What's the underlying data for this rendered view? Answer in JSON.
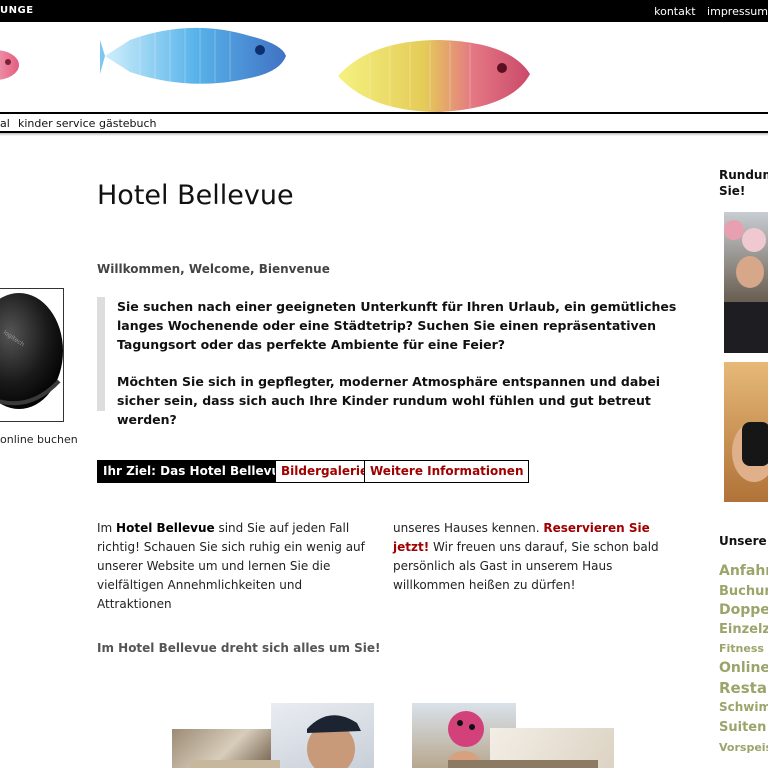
{
  "header": {
    "brand": "UNGE",
    "links": [
      "kontakt",
      "impressum"
    ]
  },
  "nav": {
    "items": [
      "al",
      "kinder",
      "service",
      "gästebuch"
    ]
  },
  "left": {
    "online_link": "online buchen"
  },
  "main": {
    "title": "Hotel Bellevue",
    "welcome": "Willkommen, Welcome, Bienvenue",
    "quote_p1": "Sie suchen nach einer geeigneten Unterkunft für Ihren Urlaub, ein gemütliches langes Wochenende oder eine Städtetrip? Suchen Sie einen repräsentativen Tagungsort oder das perfekte Ambiente für eine Feier?",
    "quote_p2": "Möchten Sie sich in gepflegter, moderner Atmosphäre entspannen und dabei sicher sein, dass sich auch Ihre Kinder rundum wohl fühlen und gut betreut werden?",
    "tabs": [
      "Ihr Ziel: Das Hotel Bellevue",
      "Bildergalerie",
      "Weitere Informationen"
    ],
    "col1_pre": "Im ",
    "col1_bold": "Hotel Bellevue",
    "col1_post": " sind Sie auf jeden Fall richtig! Schauen Sie sich ruhig ein wenig auf unserer Website um und lernen Sie die vielfältigen Annehmlichkeiten und Attraktionen",
    "col2_pre": "unseres Hauses kennen. ",
    "col2_link": "Reservieren Sie jetzt!",
    "col2_post": " Wir freuen uns darauf, Sie schon bald persönlich als Gast in unserem Haus willkommen heißen zu dürfen!",
    "subhead": "Im Hotel Bellevue dreht sich alles um Sie!"
  },
  "right": {
    "heading": "Rundum Sie!",
    "heading_line1": "Rundum",
    "heading_line2": "Sie!",
    "section": "Unsere",
    "links": [
      "Anfahrt",
      "Buchun",
      "Doppel",
      "Einzelzi",
      "Fitness u",
      "Online",
      "Restau",
      "Schwim",
      "Suiten",
      "Vorspeis"
    ]
  },
  "colors": {
    "accent_red": "#a00000",
    "tag_green": "#9aa56a",
    "bar_black": "#000000"
  }
}
